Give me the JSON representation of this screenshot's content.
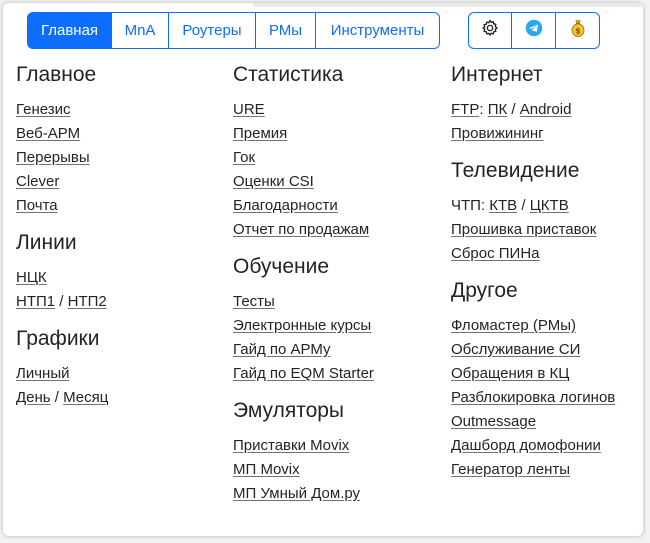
{
  "nav": {
    "tabs": [
      {
        "label": "Главная",
        "active": true
      },
      {
        "label": "MnA",
        "active": false
      },
      {
        "label": "Роутеры",
        "active": false
      },
      {
        "label": "РМы",
        "active": false
      },
      {
        "label": "Инструменты",
        "active": false
      }
    ]
  },
  "tools": {
    "buttons": [
      {
        "icon": "gear-icon"
      },
      {
        "icon": "telegram-icon"
      },
      {
        "icon": "money-bag-icon"
      }
    ]
  },
  "colors": {
    "accent": "#0d6efd",
    "text": "#212529",
    "coin": "#e0a800"
  },
  "columns": [
    {
      "sections": [
        {
          "title": "Главное",
          "rows": [
            {
              "parts": [
                {
                  "t": "Генезис",
                  "link": true
                }
              ]
            },
            {
              "parts": [
                {
                  "t": "Веб-АРМ",
                  "link": true
                }
              ]
            },
            {
              "parts": [
                {
                  "t": "Перерывы",
                  "link": true
                }
              ]
            },
            {
              "parts": [
                {
                  "t": "Clever",
                  "link": true
                }
              ]
            },
            {
              "parts": [
                {
                  "t": "Почта",
                  "link": true
                }
              ]
            }
          ]
        },
        {
          "title": "Линии",
          "rows": [
            {
              "parts": [
                {
                  "t": "НЦК",
                  "link": true
                }
              ]
            },
            {
              "parts": [
                {
                  "t": "НТП1",
                  "link": true
                },
                {
                  "t": " / ",
                  "link": false
                },
                {
                  "t": "НТП2",
                  "link": true
                }
              ]
            }
          ]
        },
        {
          "title": "Графики",
          "rows": [
            {
              "parts": [
                {
                  "t": "Личный",
                  "link": true
                }
              ]
            },
            {
              "parts": [
                {
                  "t": "День",
                  "link": true
                },
                {
                  "t": " / ",
                  "link": false
                },
                {
                  "t": "Месяц",
                  "link": true
                }
              ]
            }
          ]
        }
      ]
    },
    {
      "sections": [
        {
          "title": "Статистика",
          "rows": [
            {
              "parts": [
                {
                  "t": "URE",
                  "link": true
                }
              ]
            },
            {
              "parts": [
                {
                  "t": "Премия",
                  "link": true
                }
              ]
            },
            {
              "parts": [
                {
                  "t": "Гок",
                  "link": true
                }
              ]
            },
            {
              "parts": [
                {
                  "t": "Оценки CSI",
                  "link": true
                }
              ]
            },
            {
              "parts": [
                {
                  "t": "Благодарности",
                  "link": true
                }
              ]
            },
            {
              "parts": [
                {
                  "t": "Отчет по продажам",
                  "link": true
                }
              ]
            }
          ]
        },
        {
          "title": "Обучение",
          "rows": [
            {
              "parts": [
                {
                  "t": "Тесты",
                  "link": true
                }
              ]
            },
            {
              "parts": [
                {
                  "t": "Электронные курсы",
                  "link": true
                }
              ]
            },
            {
              "parts": [
                {
                  "t": "Гайд по АРМу",
                  "link": true
                }
              ]
            },
            {
              "parts": [
                {
                  "t": "Гайд по EQM Starter",
                  "link": true
                }
              ]
            }
          ]
        },
        {
          "title": "Эмуляторы",
          "rows": [
            {
              "parts": [
                {
                  "t": "Приставки Movix",
                  "link": true
                }
              ]
            },
            {
              "parts": [
                {
                  "t": "МП Movix",
                  "link": true
                }
              ]
            },
            {
              "parts": [
                {
                  "t": "МП Умный Дом.ру",
                  "link": true
                }
              ]
            }
          ]
        }
      ]
    },
    {
      "sections": [
        {
          "title": "Интернет",
          "rows": [
            {
              "parts": [
                {
                  "t": "FTP",
                  "link": true
                },
                {
                  "t": ": ",
                  "link": false
                },
                {
                  "t": "ПК",
                  "link": true
                },
                {
                  "t": " / ",
                  "link": false
                },
                {
                  "t": "Android",
                  "link": true
                }
              ]
            },
            {
              "parts": [
                {
                  "t": "Провижининг",
                  "link": true
                }
              ]
            }
          ]
        },
        {
          "title": "Телевидение",
          "rows": [
            {
              "parts": [
                {
                  "t": "ЧТП: ",
                  "link": false
                },
                {
                  "t": "КТВ",
                  "link": true
                },
                {
                  "t": " / ",
                  "link": false
                },
                {
                  "t": "ЦКТВ",
                  "link": true
                }
              ]
            },
            {
              "parts": [
                {
                  "t": "Прошивка приставок",
                  "link": true
                }
              ]
            },
            {
              "parts": [
                {
                  "t": "Сброс ПИНа",
                  "link": true
                }
              ]
            }
          ]
        },
        {
          "title": "Другое",
          "rows": [
            {
              "parts": [
                {
                  "t": "Фломастер (РМы)",
                  "link": true
                }
              ]
            },
            {
              "parts": [
                {
                  "t": "Обслуживание СИ",
                  "link": true
                }
              ]
            },
            {
              "parts": [
                {
                  "t": "Обращения в КЦ",
                  "link": true
                }
              ]
            },
            {
              "parts": [
                {
                  "t": "Разблокировка логинов",
                  "link": true
                }
              ]
            },
            {
              "parts": [
                {
                  "t": "Outmessage",
                  "link": true
                }
              ]
            },
            {
              "parts": [
                {
                  "t": "Дашборд домофонии",
                  "link": true
                }
              ]
            },
            {
              "parts": [
                {
                  "t": "Генератор ленты",
                  "link": true
                }
              ]
            }
          ]
        }
      ]
    }
  ]
}
